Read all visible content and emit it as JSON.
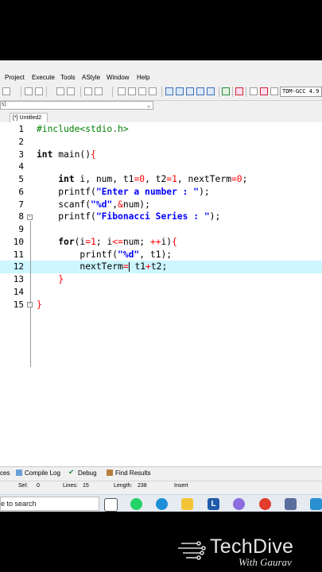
{
  "menu": [
    "Project",
    "Execute",
    "Tools",
    "AStyle",
    "Window",
    "Help"
  ],
  "toolbar": {
    "compiler": "TDM-GCC 4.9"
  },
  "tab": {
    "label": "[*] Untitled2"
  },
  "code_lines": [
    {
      "n": "1",
      "html": "<span class='pp'>#include&lt;stdio.h&gt;</span>"
    },
    {
      "n": "2",
      "html": ""
    },
    {
      "n": "3",
      "html": "<span class='kw'>int</span> main()<span class='brace'>{</span>"
    },
    {
      "n": "4",
      "html": ""
    },
    {
      "n": "5",
      "html": "    <span class='kw'>int</span> i, num, t1<span class='op'>=</span><span class='num'>0</span>, t2<span class='op'>=</span><span class='num'>1</span>, nextTerm<span class='op'>=</span><span class='num'>0</span>;"
    },
    {
      "n": "6",
      "html": "    printf(<span class='str'>\"Enter a number : \"</span>);"
    },
    {
      "n": "7",
      "html": "    scanf(<span class='str'>\"%d\"</span>,<span class='op'>&amp;</span>num);"
    },
    {
      "n": "8",
      "html": "    printf(<span class='str'>\"Fibonacci Series : \"</span>);"
    },
    {
      "n": "9",
      "html": ""
    },
    {
      "n": "10",
      "html": "    <span class='kw'>for</span>(i<span class='op'>=</span><span class='num'>1</span>; i<span class='op'>&lt;=</span>num; <span class='op'>++</span>i)<span class='brace'>{</span>"
    },
    {
      "n": "11",
      "html": "        printf(<span class='str'>\"%d\"</span>, t1);"
    },
    {
      "n": "12",
      "html": "        nextTerm<span class='op'>=</span><span class='caret'></span> t1<span class='op'>+</span>t2;"
    },
    {
      "n": "13",
      "html": "    <span class='brace'>}</span>"
    },
    {
      "n": "14",
      "html": ""
    },
    {
      "n": "15",
      "html": "<span class='brace'>}</span>"
    }
  ],
  "bottom_tabs": [
    "ces",
    "Compile Log",
    "Debug",
    "Find Results"
  ],
  "status": {
    "sel_label": "Sel:",
    "sel_value": "0",
    "lines_label": "Lines:",
    "lines_value": "15",
    "length_label": "Length:",
    "length_value": "238",
    "mode": "Insert"
  },
  "taskbar": {
    "search_text": "e to search"
  },
  "brand": {
    "title": "TechDive",
    "subtitle": "With Gaurav"
  },
  "colors": {
    "active_line": "#cdf6ff",
    "keyword": "#000000",
    "string": "#0000ff",
    "number": "#ff0000",
    "preprocessor": "#008000"
  }
}
